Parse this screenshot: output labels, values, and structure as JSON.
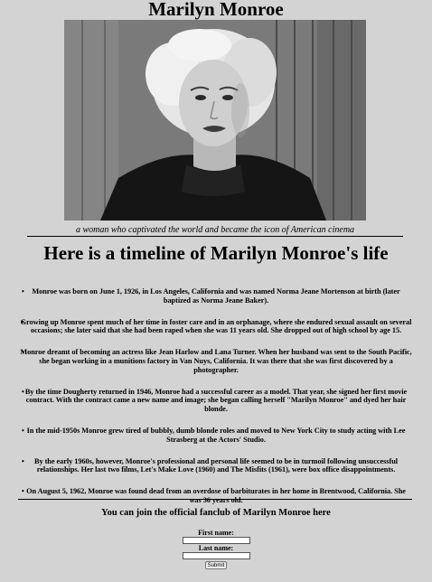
{
  "page": {
    "title": "Marilyn Monroe",
    "photo_alt": "Marilyn Monroe portrait",
    "caption": "a woman who captivated the world and became the icon of American cinema",
    "timeline_heading": "Here is a timeline of Marilyn Monroe's life"
  },
  "timeline": [
    "Monroe was born on June 1, 1926, in Los Angeles, California and was named Norma Jeane Mortenson at birth (later baptized as Norma Jeane Baker).",
    "Growing up Monroe spent much of her time in foster care and in an orphanage, where she endured sexual assault on several occasions; she later said that she had been raped when she was 11 years old. She dropped out of high school by age 15.",
    "Monroe dreamt of becoming an actress like Jean Harlow and Lana Turner. When her husband was sent to the South Pacific, she began working in a munitions factory in Van Nuys, California. It was there that she was first discovered by a photographer.",
    "By the time Dougherty returned in 1946, Monroe had a successful career as a model. That year, she signed her first movie contract. With the contract came a new name and image; she began calling herself \"Marilyn Monroe\" and dyed her hair blonde.",
    "In the mid-1950s Monroe grew tired of bubbly, dumb blonde roles and moved to New York City to study acting with Lee Strasberg at the Actors' Studio.",
    "By the early 1960s, however, Monroe's professional and personal life seemed to be in turmoil following unsuccessful relationships. Her last two films, Let's Make Love (1960) and The Misfits (1961), were box office disappointments.",
    "On August 5, 1962, Monroe was found dead from an overdose of barbiturates in her home in Brentwood, California. She was 36 years old."
  ],
  "fanclub": {
    "text": "You can join the official fanclub of Marilyn Monroe here",
    "first_name_label": "First name:",
    "last_name_label": "Last name:",
    "first_name_value": "",
    "last_name_value": "",
    "submit_label": "Submit"
  }
}
